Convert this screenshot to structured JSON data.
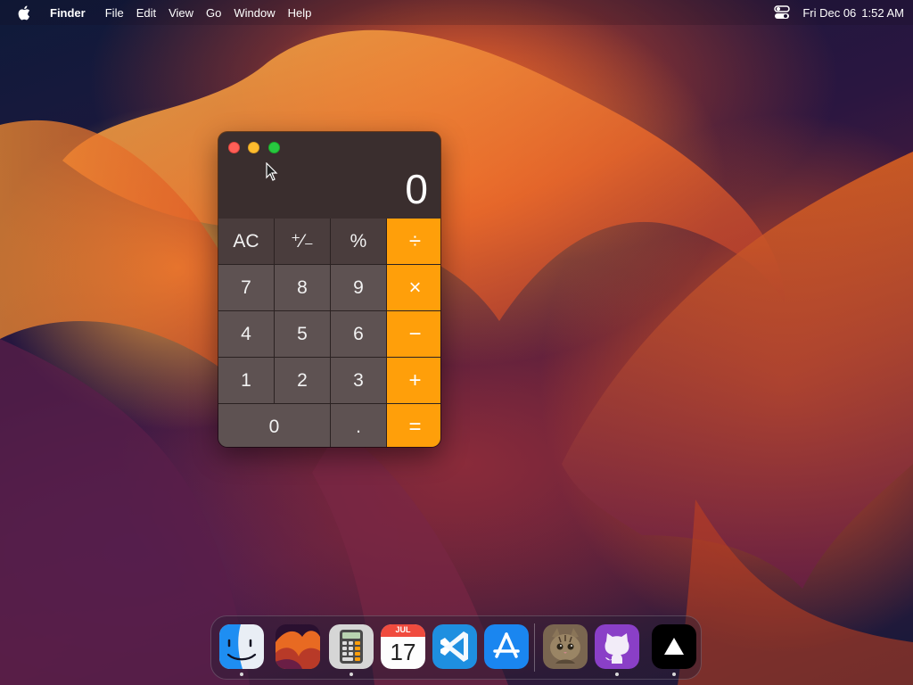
{
  "menubar": {
    "app_name": "Finder",
    "menus": [
      "File",
      "Edit",
      "View",
      "Go",
      "Window",
      "Help"
    ],
    "date": "Fri Dec 06",
    "time": "1:52 AM"
  },
  "calculator": {
    "display": "0",
    "keys": {
      "clear": "AC",
      "sign": "⁺∕₋",
      "percent": "%",
      "divide": "÷",
      "seven": "7",
      "eight": "8",
      "nine": "9",
      "multiply": "×",
      "four": "4",
      "five": "5",
      "six": "6",
      "minus": "−",
      "one": "1",
      "two": "2",
      "three": "3",
      "plus": "+",
      "zero": "0",
      "decimal": ".",
      "equals": "="
    },
    "colors": {
      "operator": "#ff9f0a",
      "digit": "#5e5252",
      "function": "#4a3d3d"
    }
  },
  "dock": {
    "apps": [
      {
        "icon": "finder-icon",
        "running": true
      },
      {
        "icon": "wallpaper-icon",
        "running": false
      },
      {
        "icon": "calculator-icon",
        "running": true
      },
      {
        "icon": "calendar-icon",
        "running": false,
        "month": "JUL",
        "day": "17"
      },
      {
        "icon": "vscode-icon",
        "running": false
      },
      {
        "icon": "app-store-icon",
        "running": false
      },
      {
        "icon": "cat-photo-icon",
        "running": false
      },
      {
        "icon": "github-icon",
        "running": true
      },
      {
        "icon": "vercel-icon",
        "running": true
      }
    ]
  }
}
